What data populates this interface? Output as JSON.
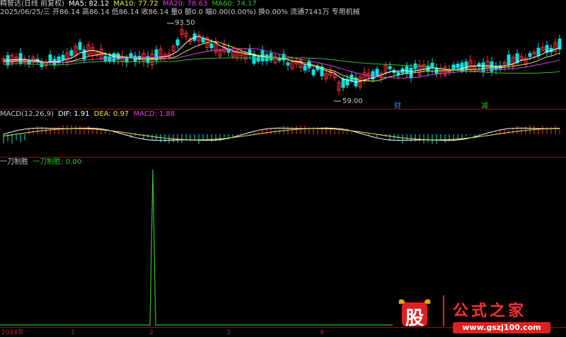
{
  "main": {
    "title": "精智达(日线 前复权)",
    "ma5": "MA5: 82.12",
    "ma10": "MA10: 77.72",
    "ma20": "MA20: 78.63",
    "ma60": "MA60: 74.17",
    "quote": "2025/06/25/三 开86.14 高86.14 低86.14 收86.14 量0 额0.0 幅0.00(0.00%) 换0.00% 流通7141万 专用机械",
    "high_label": "93.50",
    "low_label": "59.00",
    "events": [
      "财",
      "减"
    ],
    "colors": {
      "up": "#ff3232",
      "down": "#00e4e4",
      "ma5": "#ffffff",
      "ma10": "#e8e840",
      "ma20": "#e040e0",
      "ma60": "#30c030"
    }
  },
  "macd": {
    "title": "MACD(12,26,9)",
    "dif": "DIF: 1.91",
    "dea": "DEA: 0.97",
    "macd": "MACD: 1.88"
  },
  "indicator": {
    "name": "一刀制胜",
    "value_label": "一刀制胜: 0.00",
    "spike_value": 1
  },
  "time_axis": [
    "2024年",
    "1",
    "2",
    "3",
    "4"
  ],
  "watermark": {
    "logo": "股",
    "text": "公式之家",
    "url": "www.gszj100.com"
  }
}
